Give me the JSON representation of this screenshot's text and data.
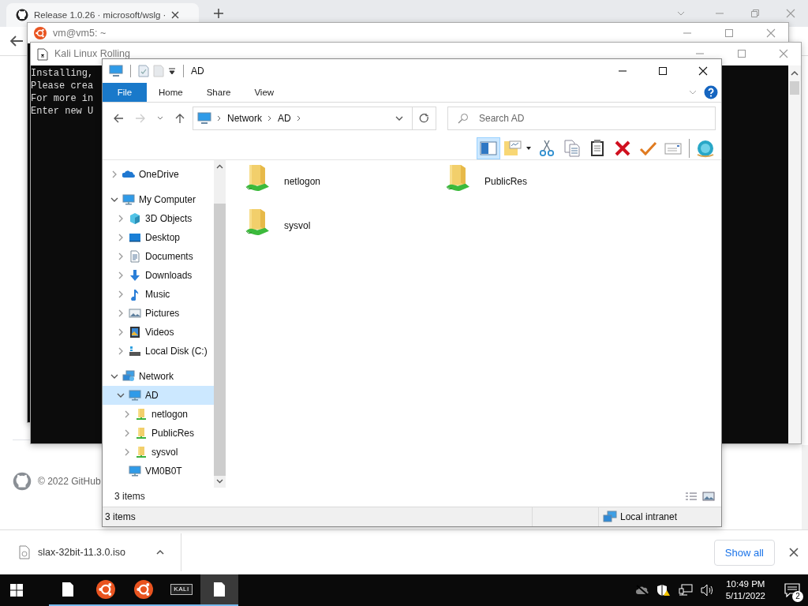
{
  "browser": {
    "tab": {
      "title": "Release 1.0.26 · microsoft/wslg ·"
    },
    "footer": "© 2022 GitHub",
    "download": {
      "file": "slax-32bit-11.3.0.iso",
      "show_all": "Show all"
    }
  },
  "vm_window": {
    "title": "vm@vm5: ~"
  },
  "kali_window": {
    "title": "Kali Linux Rolling",
    "lines": [
      "Installing,",
      "Please crea",
      "For more in",
      "Enter new U"
    ]
  },
  "explorer": {
    "title": "AD",
    "ribbon_tabs": [
      {
        "label": "File",
        "kind": "menu"
      },
      {
        "label": "Home",
        "kind": "tab"
      },
      {
        "label": "Share",
        "kind": "tab"
      },
      {
        "label": "View",
        "kind": "tab"
      }
    ],
    "address": {
      "crumbs": [
        "Network",
        "AD"
      ]
    },
    "search": {
      "placeholder": "Search AD"
    },
    "toolbar": [
      {
        "kind": "preview-pane",
        "selected": true
      },
      {
        "kind": "folder-menu",
        "selected": false
      },
      {
        "kind": "cut",
        "selected": false
      },
      {
        "kind": "copy",
        "selected": false
      },
      {
        "kind": "paste",
        "selected": false
      },
      {
        "kind": "delete",
        "selected": false
      },
      {
        "kind": "check",
        "selected": false
      },
      {
        "kind": "card",
        "selected": false
      },
      {
        "kind": "globe",
        "selected": false
      }
    ],
    "tree": [
      {
        "label": "OneDrive",
        "kind": "onedrive",
        "expanded": false,
        "selected": false
      },
      {
        "label": "My Computer",
        "kind": "computer",
        "expanded": true,
        "selected": false,
        "children": [
          {
            "label": "3D Objects",
            "kind": "cube",
            "expanded": false,
            "selected": false
          },
          {
            "label": "Desktop",
            "kind": "desktop",
            "expanded": false,
            "selected": false
          },
          {
            "label": "Documents",
            "kind": "documents",
            "expanded": false,
            "selected": false
          },
          {
            "label": "Downloads",
            "kind": "downloads",
            "expanded": false,
            "selected": false
          },
          {
            "label": "Music",
            "kind": "music",
            "expanded": false,
            "selected": false
          },
          {
            "label": "Pictures",
            "kind": "pictures",
            "expanded": false,
            "selected": false
          },
          {
            "label": "Videos",
            "kind": "videos",
            "expanded": false,
            "selected": false
          },
          {
            "label": "Local Disk (C:)",
            "kind": "disk",
            "expanded": false,
            "selected": false
          }
        ]
      },
      {
        "label": "Network",
        "kind": "network",
        "expanded": true,
        "selected": false,
        "children": [
          {
            "label": "AD",
            "kind": "computer",
            "expanded": true,
            "selected": true,
            "children": [
              {
                "label": "netlogon",
                "kind": "share",
                "expanded": false,
                "selected": false
              },
              {
                "label": "PublicRes",
                "kind": "share",
                "expanded": false,
                "selected": false
              },
              {
                "label": "sysvol",
                "kind": "share",
                "expanded": false,
                "selected": false
              }
            ]
          },
          {
            "label": "VM0B0T",
            "kind": "computer",
            "selected": false
          }
        ]
      }
    ],
    "items": [
      {
        "label": "netlogon",
        "selected": false
      },
      {
        "label": "PublicRes",
        "selected": false
      },
      {
        "label": "sysvol",
        "selected": false
      }
    ],
    "item_count": "3 items",
    "status": {
      "count": "3 items",
      "zone": "Local intranet"
    }
  },
  "taskbar": {
    "apps": [
      {
        "kind": "file",
        "active": false
      },
      {
        "kind": "ubuntu",
        "active": false
      },
      {
        "kind": "ubuntu",
        "active": false
      },
      {
        "kind": "kali",
        "label": "KALI",
        "active": false
      },
      {
        "kind": "file",
        "active": true
      }
    ],
    "time": "10:49 PM",
    "date": "5/11/2022",
    "notifications": "2"
  }
}
